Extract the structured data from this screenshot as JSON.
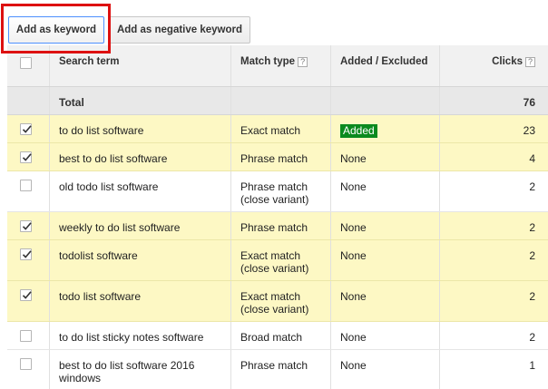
{
  "toolbar": {
    "add_keyword_label": "Add as keyword",
    "add_negative_label": "Add as negative keyword"
  },
  "table": {
    "headers": {
      "search_term": "Search term",
      "match_type": "Match type",
      "added_excluded": "Added / Excluded",
      "clicks": "Clicks"
    },
    "help_glyph": "?",
    "total": {
      "label": "Total",
      "clicks": "76"
    },
    "rows": [
      {
        "checked": true,
        "term": "to do list software",
        "match": "Exact match",
        "status": "Added",
        "status_badge": true,
        "clicks": "23"
      },
      {
        "checked": true,
        "term": "best to do list software",
        "match": "Phrase match",
        "status": "None",
        "status_badge": false,
        "clicks": "4"
      },
      {
        "checked": false,
        "term": "old todo list software",
        "match": "Phrase match (close variant)",
        "status": "None",
        "status_badge": false,
        "clicks": "2"
      },
      {
        "checked": true,
        "term": "weekly to do list software",
        "match": "Phrase match",
        "status": "None",
        "status_badge": false,
        "clicks": "2"
      },
      {
        "checked": true,
        "term": "todolist software",
        "match": "Exact match (close variant)",
        "status": "None",
        "status_badge": false,
        "clicks": "2"
      },
      {
        "checked": true,
        "term": "todo list software",
        "match": "Exact match (close variant)",
        "status": "None",
        "status_badge": false,
        "clicks": "2"
      },
      {
        "checked": false,
        "term": "to do list sticky notes software",
        "match": "Broad match",
        "status": "None",
        "status_badge": false,
        "clicks": "2"
      },
      {
        "checked": false,
        "term": "best to do list software 2016 windows",
        "match": "Phrase match",
        "status": "None",
        "status_badge": false,
        "clicks": "1"
      }
    ]
  },
  "colors": {
    "selected_row": "#fdf8c4",
    "added_badge": "#0a8a1e",
    "highlight_border": "#dd1111"
  }
}
